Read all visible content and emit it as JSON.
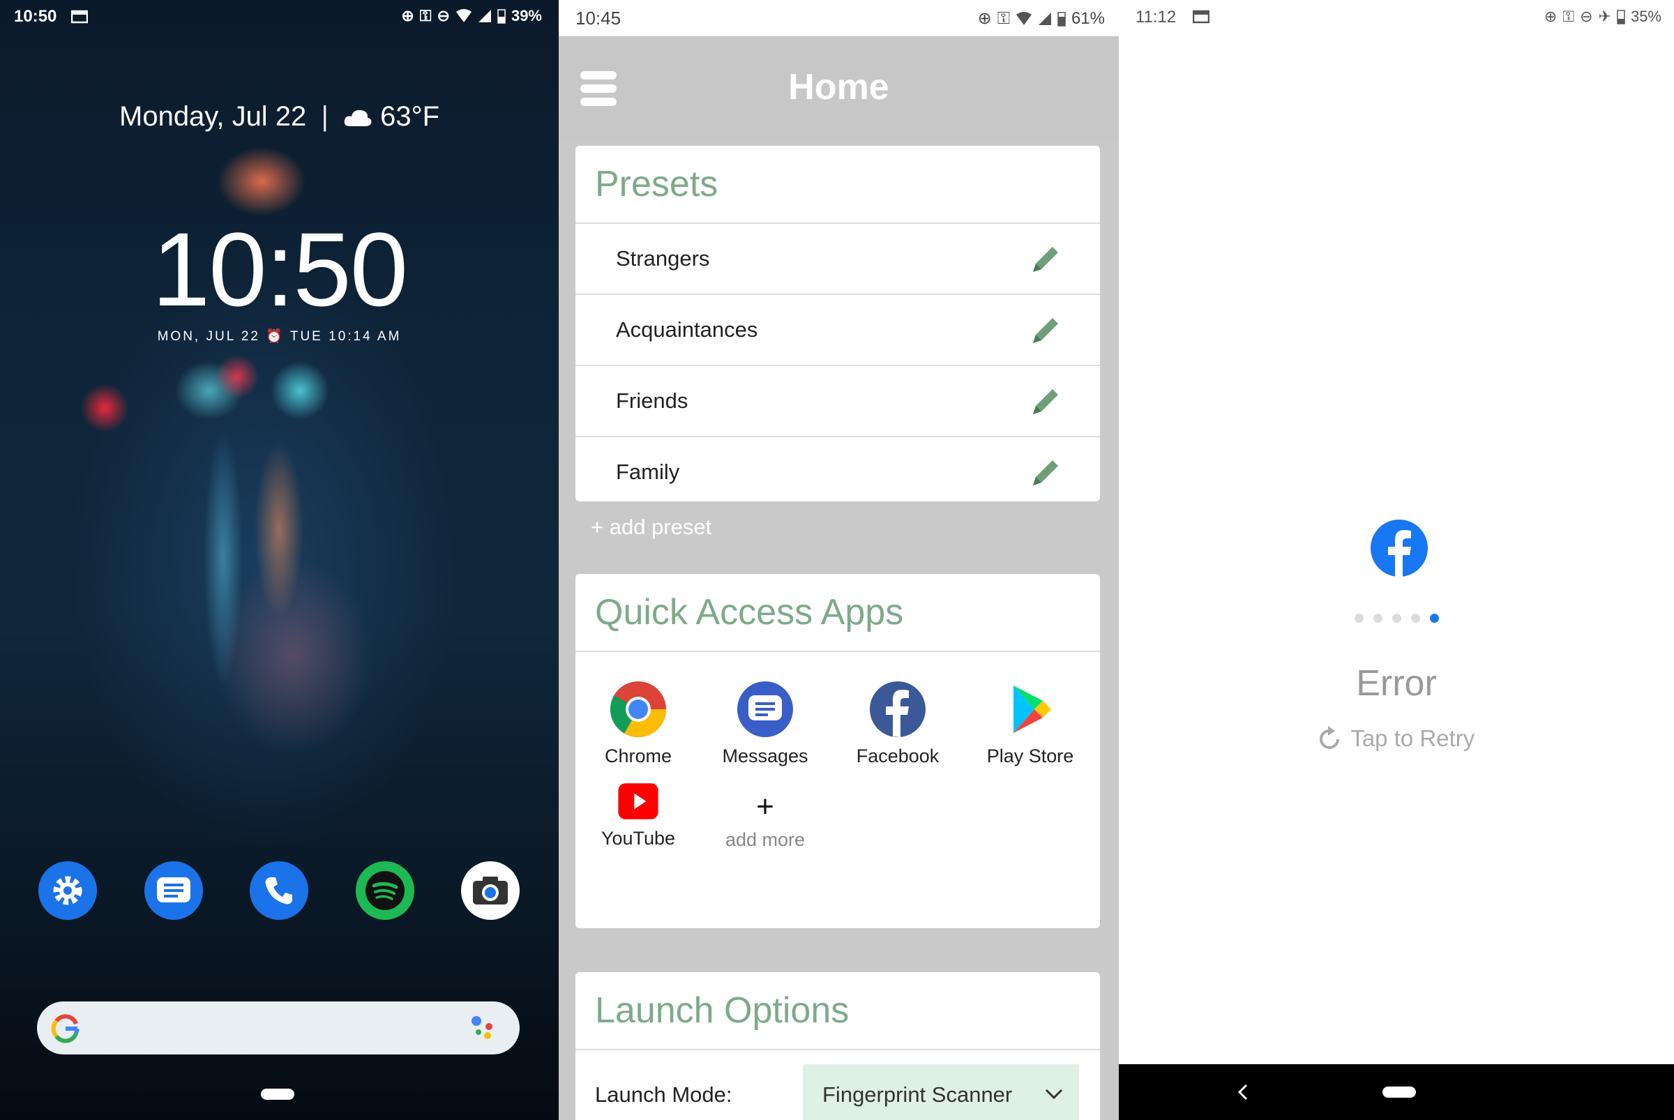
{
  "lockscreen": {
    "status_time": "10:50",
    "battery": "39%",
    "date": "Monday, Jul 22",
    "weather": "63°F",
    "clock": "10:50",
    "alarm": "MON, JUL 22 ⏰ TUE 10:14 AM",
    "dock": [
      "settings-icon",
      "messages-icon",
      "phone-icon",
      "spotify-icon",
      "camera-icon"
    ]
  },
  "app": {
    "status_time": "10:45",
    "battery": "61%",
    "header_title": "Home",
    "presets_title": "Presets",
    "presets": [
      {
        "label": "Strangers"
      },
      {
        "label": "Acquaintances"
      },
      {
        "label": "Friends"
      },
      {
        "label": "Family"
      }
    ],
    "add_preset": "+ add preset",
    "quick_title": "Quick Access Apps",
    "apps": [
      {
        "label": "Chrome"
      },
      {
        "label": "Messages"
      },
      {
        "label": "Facebook"
      },
      {
        "label": "Play Store"
      },
      {
        "label": "YouTube"
      }
    ],
    "add_more": "add more",
    "launch_title": "Launch Options",
    "launch_mode_label": "Launch Mode:",
    "launch_mode_value": "Fingerprint Scanner"
  },
  "error_screen": {
    "status_time": "11:12",
    "battery": "35%",
    "error_text": "Error",
    "retry_text": "Tap to Retry",
    "progress_dots": 5,
    "active_dot": 5
  },
  "colors": {
    "accent_green": "#7daa8a",
    "pencil_green": "#6f9e7a",
    "facebook_blue": "#1877f2",
    "dropdown_bg": "#dff0e4"
  }
}
